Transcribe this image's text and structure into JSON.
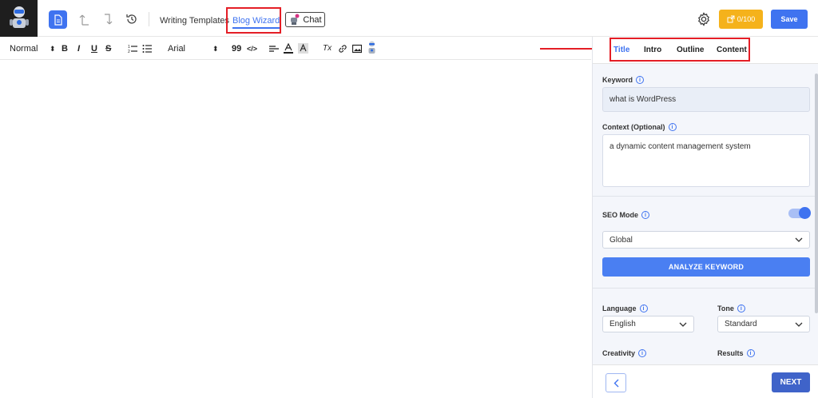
{
  "header": {
    "nav": {
      "writing_templates": "Writing Templates",
      "blog_wizard": "Blog Wizard",
      "chat": "Chat"
    },
    "credits": "0/100",
    "save": "Save"
  },
  "toolbar": {
    "paragraph_style": "Normal",
    "bold": "B",
    "italic": "I",
    "underline": "U",
    "strike": "S",
    "font": "Arial",
    "quote": "99",
    "code": "</>",
    "clear_format": "Tx"
  },
  "panel": {
    "tabs": [
      "Title",
      "Intro",
      "Outline",
      "Content"
    ],
    "active_tab": "Title",
    "keyword": {
      "label": "Keyword",
      "value": "what is WordPress"
    },
    "context": {
      "label": "Context (Optional)",
      "value": "a dynamic content management system"
    },
    "seo_mode": {
      "label": "SEO Mode",
      "enabled": true
    },
    "region": "Global",
    "analyze_button": "ANALYZE KEYWORD",
    "language": {
      "label": "Language",
      "value": "English"
    },
    "tone": {
      "label": "Tone",
      "value": "Standard"
    },
    "creativity_label": "Creativity",
    "results_label": "Results",
    "next_button": "NEXT"
  },
  "colors": {
    "primary": "#3f73f0",
    "credits_bg": "#f5b21b",
    "annotation_red": "#e41e26",
    "panel_bg": "#f4f6fb"
  }
}
